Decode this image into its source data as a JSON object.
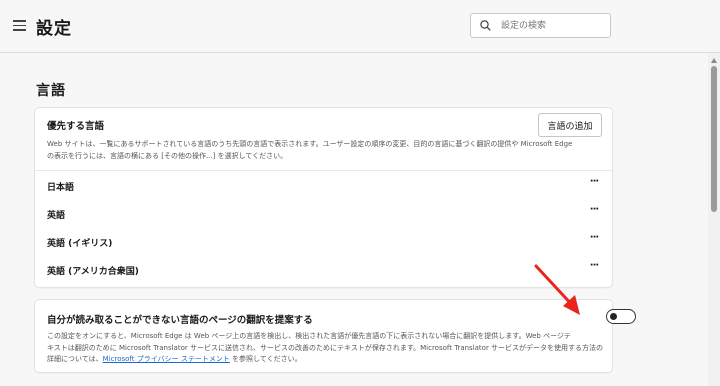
{
  "header": {
    "title": "設定",
    "search_placeholder": "設定の検索"
  },
  "section": {
    "title": "言語"
  },
  "preferred_languages": {
    "heading": "優先する言語",
    "add_button": "言語の追加",
    "description_line1": "Web サイトは、一覧にあるサポートされている言語のうち先頭の言語で表示されます。ユーザー設定の順序の変更、目的の言語に基づく翻訳の提供や Microsoft Edge",
    "description_line2": "の表示を行うには、言語の横にある [その他の操作...] を選択してください。",
    "languages": [
      {
        "label": "日本語",
        "more": "···"
      },
      {
        "label": "英語",
        "more": "···"
      },
      {
        "label": "英語 (イギリス)",
        "more": "···"
      },
      {
        "label": "英語 (アメリカ合衆国)",
        "more": "···"
      }
    ]
  },
  "translate": {
    "heading": "自分が読み取ることができない言語のページの翻訳を提案する",
    "toggle_on": false,
    "description_line1": "この設定をオンにすると、Microsoft Edge は Web ページ上の言語を検出し、検出された言語が優先言語の下に表示されない場合に翻訳を提供します。Web ページテ",
    "description_line2": "キストは翻訳のために Microsoft Translator サービスに送信され、サービスの改善のためにテキストが保存されます。Microsoft Translator サービスがデータを使用する方法の",
    "description_line3_prefix": "詳細については、",
    "link_text": "Microsoft プライバシー ステートメント",
    "description_line3_suffix": " を参照してください。"
  },
  "colors": {
    "accent": "#1a6bc9",
    "annotation_arrow": "#e8241c"
  }
}
